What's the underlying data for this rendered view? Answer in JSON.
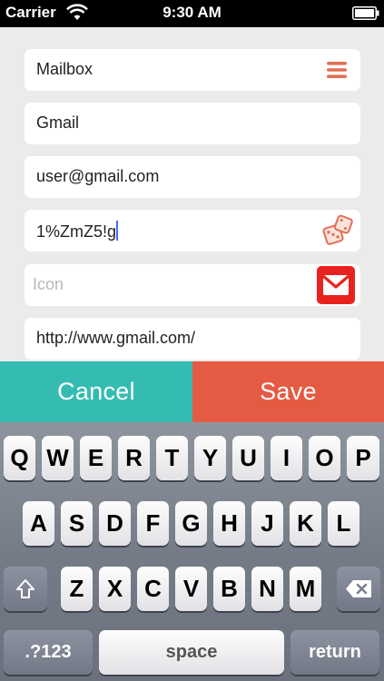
{
  "status_bar": {
    "carrier": "Carrier",
    "time": "9:30 AM"
  },
  "form": {
    "mailbox_label": "Mailbox",
    "name_value": "Gmail",
    "email_value": "user@gmail.com",
    "password_value": "1%ZmZ5!g",
    "icon_placeholder": "Icon",
    "url_value": "http://www.gmail.com/"
  },
  "actions": {
    "cancel": "Cancel",
    "save": "Save"
  },
  "keyboard": {
    "row1": [
      "Q",
      "W",
      "E",
      "R",
      "T",
      "Y",
      "U",
      "I",
      "O",
      "P"
    ],
    "row2": [
      "A",
      "S",
      "D",
      "F",
      "G",
      "H",
      "J",
      "K",
      "L"
    ],
    "row3": [
      "Z",
      "X",
      "C",
      "V",
      "B",
      "N",
      "M"
    ],
    "numbers": ".?123",
    "space": "space",
    "return": "return"
  },
  "colors": {
    "cancel": "#35bcb2",
    "save": "#e55a42",
    "accent": "#e8231f",
    "icon": "#e07055"
  },
  "icons": [
    "wifi-icon",
    "battery-icon",
    "menu-icon",
    "dice-icon",
    "mail-icon",
    "shift-icon",
    "backspace-icon"
  ]
}
